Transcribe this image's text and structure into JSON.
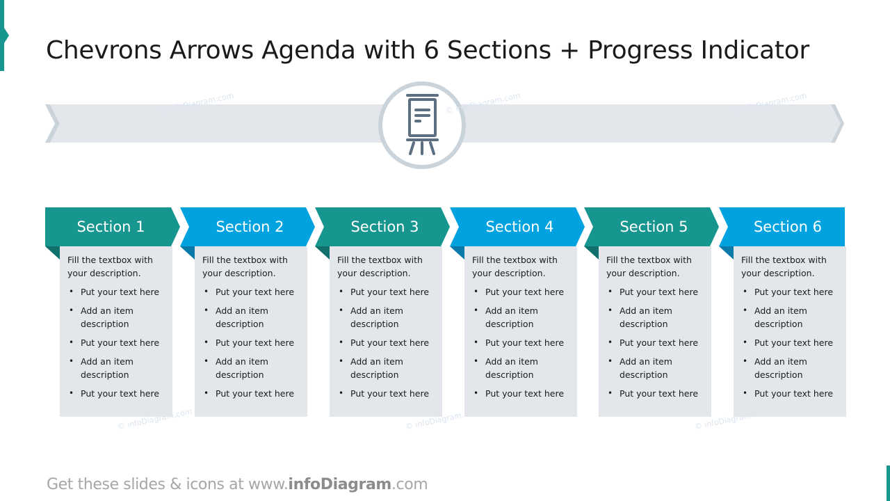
{
  "slide": {
    "title": "Chevrons Arrows Agenda with 6 Sections + Progress Indicator",
    "progress_icon": "presentation-easel-icon",
    "watermark": "© infoDiagram.com",
    "footer": {
      "prefix": "Get these slides & icons at www.",
      "brand": "infoDiagram",
      "suffix": ".com"
    },
    "colors": {
      "teal": "#17968F",
      "teal_fold": "#10706B",
      "blue": "#00A3E0",
      "blue_fold": "#0A7BA8",
      "box_bg": "#E3E7EC",
      "bar_bg": "#E3E7EC",
      "bar_edge": "#CBD3DA",
      "icon": "#5C6E82"
    }
  },
  "sections": [
    {
      "title": "Section 1",
      "color": "teal",
      "intro": "Fill the textbox with your description.",
      "items": [
        "Put your text here",
        "Add an item description",
        "Put your text here",
        "Add an item description",
        "Put your text here"
      ]
    },
    {
      "title": "Section 2",
      "color": "blue",
      "intro": "Fill the textbox with your description.",
      "items": [
        "Put your text here",
        "Add an item description",
        "Put your text here",
        "Add an item description",
        "Put your text here"
      ]
    },
    {
      "title": "Section 3",
      "color": "teal",
      "intro": "Fill the textbox with your description.",
      "items": [
        "Put your text here",
        "Add an item description",
        "Put your text here",
        "Add an item description",
        "Put your text here"
      ]
    },
    {
      "title": "Section 4",
      "color": "blue",
      "intro": "Fill the textbox with your description.",
      "items": [
        "Put your text here",
        "Add an item description",
        "Put your text here",
        "Add an item description",
        "Put your text here"
      ]
    },
    {
      "title": "Section 5",
      "color": "teal",
      "intro": "Fill the textbox with your description.",
      "items": [
        "Put your text here",
        "Add an item description",
        "Put your text here",
        "Add an item description",
        "Put your text here"
      ]
    },
    {
      "title": "Section 6",
      "color": "blue",
      "intro": "Fill the textbox with your description.",
      "items": [
        "Put your text here",
        "Add an item description",
        "Put your text here",
        "Add an item description",
        "Put your text here"
      ]
    }
  ]
}
